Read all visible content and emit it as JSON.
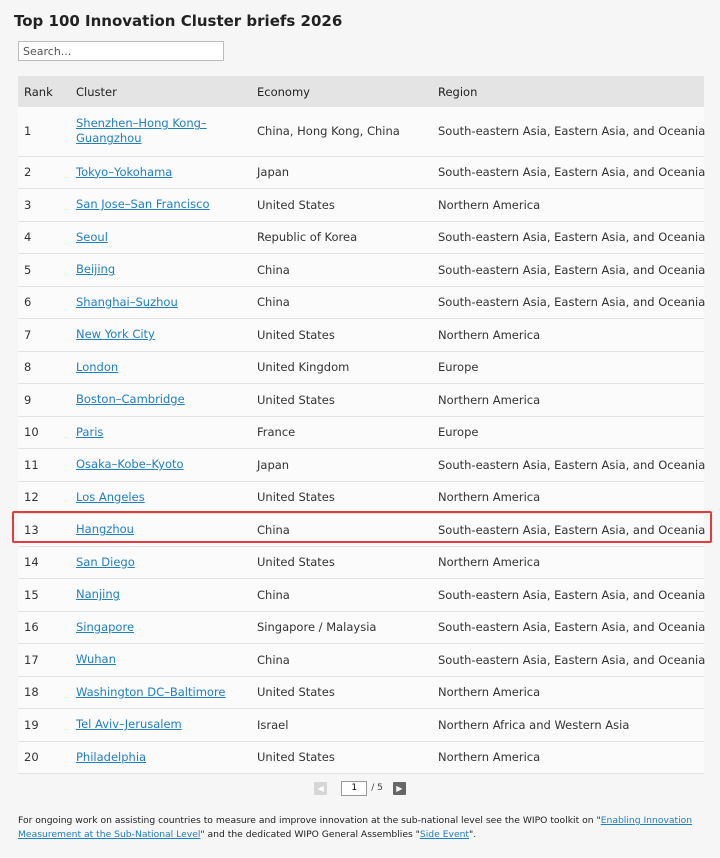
{
  "page": {
    "title": "Top 100 Innovation Cluster briefs 2026",
    "search_placeholder": "Search..."
  },
  "table": {
    "headers": {
      "rank": "Rank",
      "cluster": "Cluster",
      "economy": "Economy",
      "region": "Region"
    },
    "rows": [
      {
        "rank": "1",
        "cluster": "Shenzhen–Hong Kong–Guangzhou",
        "economy": "China, Hong Kong, China",
        "region": "South-eastern Asia, Eastern Asia, and Oceania"
      },
      {
        "rank": "2",
        "cluster": "Tokyo–Yokohama",
        "economy": "Japan",
        "region": "South-eastern Asia, Eastern Asia, and Oceania"
      },
      {
        "rank": "3",
        "cluster": "San Jose–San Francisco",
        "economy": "United States",
        "region": "Northern America"
      },
      {
        "rank": "4",
        "cluster": "Seoul",
        "economy": "Republic of Korea",
        "region": "South-eastern Asia, Eastern Asia, and Oceania"
      },
      {
        "rank": "5",
        "cluster": "Beijing",
        "economy": "China",
        "region": "South-eastern Asia, Eastern Asia, and Oceania"
      },
      {
        "rank": "6",
        "cluster": "Shanghai–Suzhou",
        "economy": "China",
        "region": "South-eastern Asia, Eastern Asia, and Oceania"
      },
      {
        "rank": "7",
        "cluster": "New York City",
        "economy": "United States",
        "region": "Northern America"
      },
      {
        "rank": "8",
        "cluster": "London",
        "economy": "United Kingdom",
        "region": "Europe"
      },
      {
        "rank": "9",
        "cluster": "Boston–Cambridge",
        "economy": "United States",
        "region": "Northern America"
      },
      {
        "rank": "10",
        "cluster": "Paris",
        "economy": "France",
        "region": "Europe"
      },
      {
        "rank": "11",
        "cluster": "Osaka–Kobe–Kyoto",
        "economy": "Japan",
        "region": "South-eastern Asia, Eastern Asia, and Oceania"
      },
      {
        "rank": "12",
        "cluster": "Los Angeles",
        "economy": "United States",
        "region": "Northern America"
      },
      {
        "rank": "13",
        "cluster": "Hangzhou",
        "economy": "China",
        "region": "South-eastern Asia, Eastern Asia, and Oceania"
      },
      {
        "rank": "14",
        "cluster": "San Diego",
        "economy": "United States",
        "region": "Northern America"
      },
      {
        "rank": "15",
        "cluster": "Nanjing",
        "economy": "China",
        "region": "South-eastern Asia, Eastern Asia, and Oceania"
      },
      {
        "rank": "16",
        "cluster": "Singapore",
        "economy": "Singapore / Malaysia",
        "region": "South-eastern Asia, Eastern Asia, and Oceania"
      },
      {
        "rank": "17",
        "cluster": "Wuhan",
        "economy": "China",
        "region": "South-eastern Asia, Eastern Asia, and Oceania"
      },
      {
        "rank": "18",
        "cluster": "Washington DC–Baltimore",
        "economy": "United States",
        "region": "Northern America"
      },
      {
        "rank": "19",
        "cluster": "Tel Aviv–Jerusalem",
        "economy": "Israel",
        "region": "Northern Africa and Western Asia"
      },
      {
        "rank": "20",
        "cluster": "Philadelphia",
        "economy": "United States",
        "region": "Northern America"
      }
    ]
  },
  "pager": {
    "current_page": "1",
    "total_label": "/ 5",
    "prev_icon": "chevron-left-icon",
    "next_icon": "chevron-right-icon"
  },
  "footer": {
    "text_1": "For ongoing work on assisting countries to measure and improve innovation at the sub-national level see the WIPO toolkit on \"",
    "link_1": "Enabling Innovation Measurement at the Sub-National Level",
    "text_2": "\" and the dedicated WIPO General Assemblies \"",
    "link_2": "Side Event",
    "text_3": "\"."
  },
  "colors": {
    "link": "#1f7fc2",
    "highlight_border": "#e53b3b",
    "header_bg": "#e4e4e4",
    "page_bg": "#f6f6f6"
  }
}
